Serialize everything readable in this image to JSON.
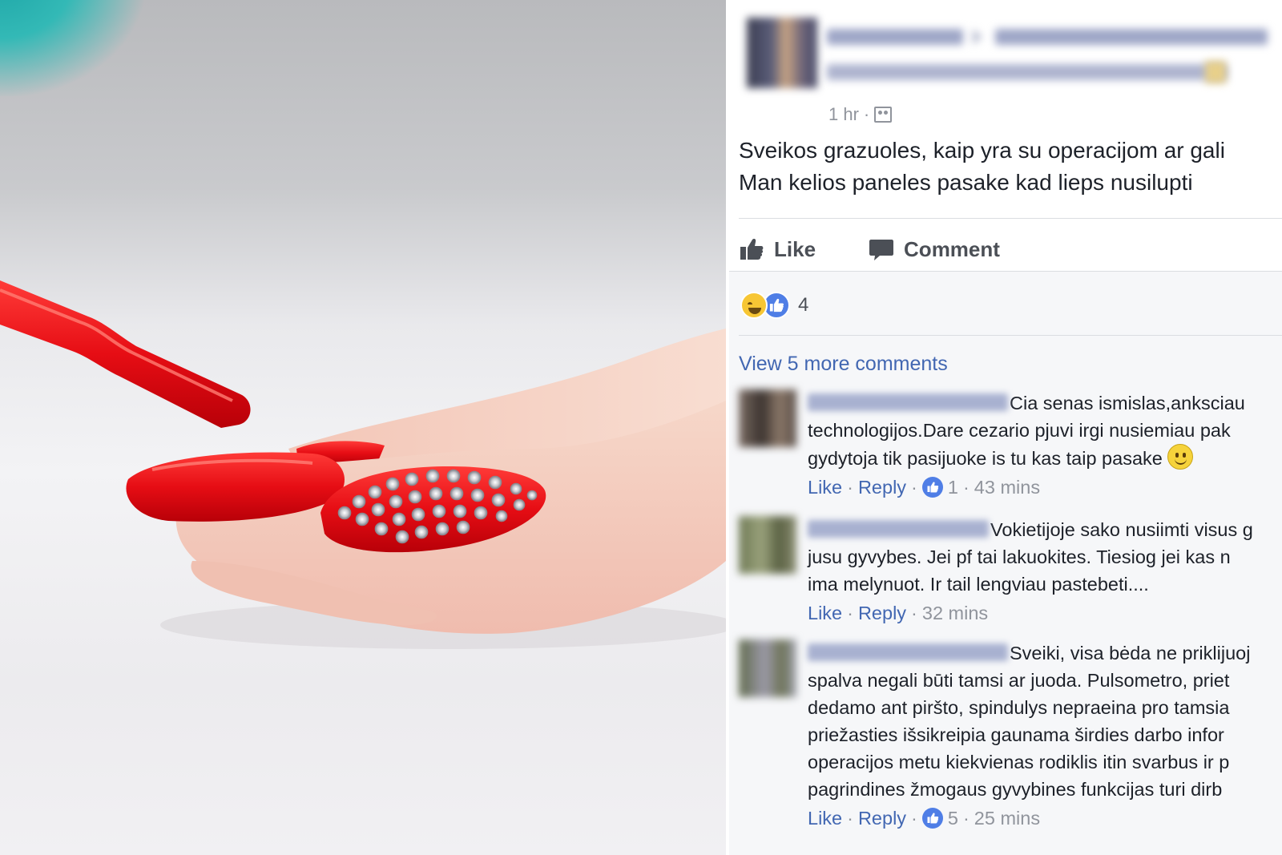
{
  "post": {
    "time": "1 hr",
    "audience_icon": "friends-icon",
    "text_lines": [
      "Sveikos grazuoles, kaip yra su operacijom ar gali",
      "Man kelios paneles pasake kad lieps nusilupti"
    ]
  },
  "actions": {
    "like_label": "Like",
    "comment_label": "Comment"
  },
  "reactions": {
    "icons": [
      "haha-icon",
      "like-icon"
    ],
    "count": "4"
  },
  "view_more": "View 5 more comments",
  "comments": [
    {
      "lines": [
        "Cia senas ismislas,anksciau",
        "technologijos.Dare cezario pjuvi irgi nusiemiau pak",
        "gydytoja tik pasijuoke is tu kas taip pasake"
      ],
      "like": "Like",
      "reply": "Reply",
      "likes": "1",
      "time": "43 mins"
    },
    {
      "lines": [
        "Vokietijoje sako nusiimti visus g",
        "jusu gyvybes. Jei pf tai lakuokites. Tiesiog jei kas n",
        "ima melynuot. Ir tail lengviau pastebeti...."
      ],
      "like": "Like",
      "reply": "Reply",
      "time": "32 mins"
    },
    {
      "lines": [
        "Sveiki, visa bėda ne priklijuoj",
        "spalva negali būti tamsi ar juoda. Pulsometro, priet",
        "dedamo ant piršto, spindulys nepraeina pro tamsia",
        "priežasties išsikreipia gaunama širdies darbo infor",
        "operacijos metu kiekvienas rodiklis itin svarbus ir p",
        "pagrindines žmogaus gyvybines funkcijas turi dirb"
      ],
      "like": "Like",
      "reply": "Reply",
      "likes": "5",
      "time": "25 mins"
    }
  ],
  "colors": {
    "link": "#4267b2",
    "nail": "#e5101a",
    "reaction_blue": "#4f7ee6"
  }
}
